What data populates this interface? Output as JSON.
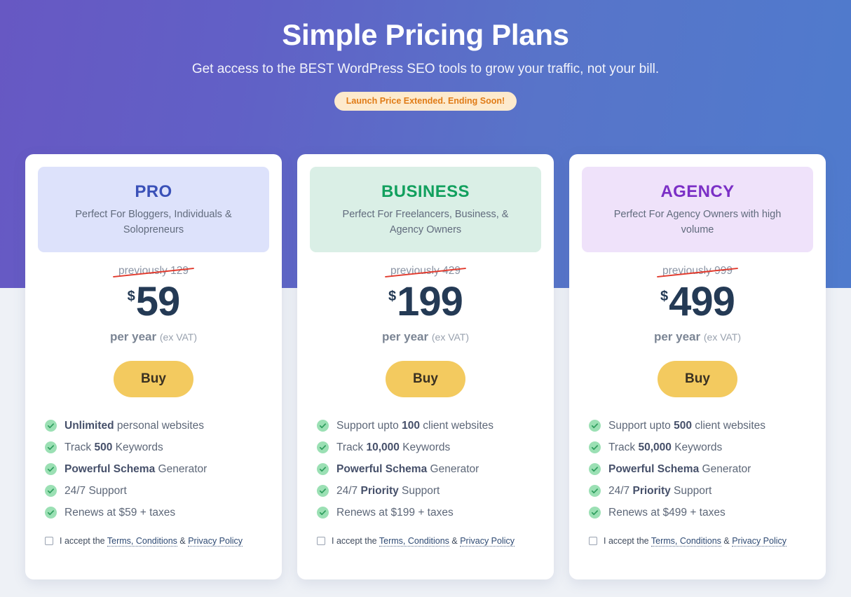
{
  "hero": {
    "title": "Simple Pricing Plans",
    "subtitle": "Get access to the BEST WordPress SEO tools to grow your traffic, not your bill.",
    "badge": "Launch Price Extended. Ending Soon!",
    "badge_bg": "#fdeacd",
    "badge_color": "#e07b16",
    "gradient_from": "#6758c3",
    "gradient_to": "#4f7bcd"
  },
  "page": {
    "background": "#eef1f6"
  },
  "common": {
    "buy_label": "Buy",
    "per_year_label": "per year",
    "vat_note": "(ex VAT)",
    "currency_symbol": "$",
    "terms_prefix": "I accept the ",
    "terms_link_1": "Terms, Conditions",
    "terms_amp": " & ",
    "terms_link_2": "Privacy Policy",
    "check_icon": "check-circle-icon",
    "checkbox_icon": "checkbox-unchecked-icon"
  },
  "plans": [
    {
      "id": "pro",
      "name": "PRO",
      "name_color": "#3a51b8",
      "header_bg": "#dde2fb",
      "description": "Perfect For Bloggers, Individuals & Solopreneurs",
      "previous_price": "previously 129",
      "price": "59",
      "features": [
        {
          "bold": "Unlimited",
          "rest": " personal websites",
          "lead": ""
        },
        {
          "lead": "Track ",
          "bold": "500",
          "rest": " Keywords"
        },
        {
          "lead": "",
          "bold": "Powerful Schema",
          "rest": " Generator"
        },
        {
          "lead": "24/7 Support",
          "bold": "",
          "rest": ""
        },
        {
          "lead": "Renews at $59 + taxes",
          "bold": "",
          "rest": ""
        }
      ]
    },
    {
      "id": "business",
      "name": "BUSINESS",
      "name_color": "#12a05e",
      "header_bg": "#daefe6",
      "description": "Perfect For Freelancers, Business, & Agency Owners",
      "previous_price": "previously 429",
      "price": "199",
      "features": [
        {
          "lead": "Support upto ",
          "bold": "100",
          "rest": " client websites"
        },
        {
          "lead": "Track ",
          "bold": "10,000",
          "rest": " Keywords"
        },
        {
          "lead": "",
          "bold": "Powerful Schema",
          "rest": " Generator"
        },
        {
          "lead": "24/7 ",
          "bold": "Priority",
          "rest": " Support"
        },
        {
          "lead": "Renews at $199 + taxes",
          "bold": "",
          "rest": ""
        }
      ]
    },
    {
      "id": "agency",
      "name": "AGENCY",
      "name_color": "#7b2fc6",
      "header_bg": "#efe2fa",
      "description": "Perfect For Agency Owners with high volume",
      "previous_price": "previously 999",
      "price": "499",
      "features": [
        {
          "lead": "Support upto ",
          "bold": "500",
          "rest": " client websites"
        },
        {
          "lead": "Track ",
          "bold": "50,000",
          "rest": " Keywords"
        },
        {
          "lead": "",
          "bold": "Powerful Schema",
          "rest": " Generator"
        },
        {
          "lead": "24/7 ",
          "bold": "Priority",
          "rest": " Support"
        },
        {
          "lead": "Renews at $499 + taxes",
          "bold": "",
          "rest": ""
        }
      ]
    }
  ]
}
